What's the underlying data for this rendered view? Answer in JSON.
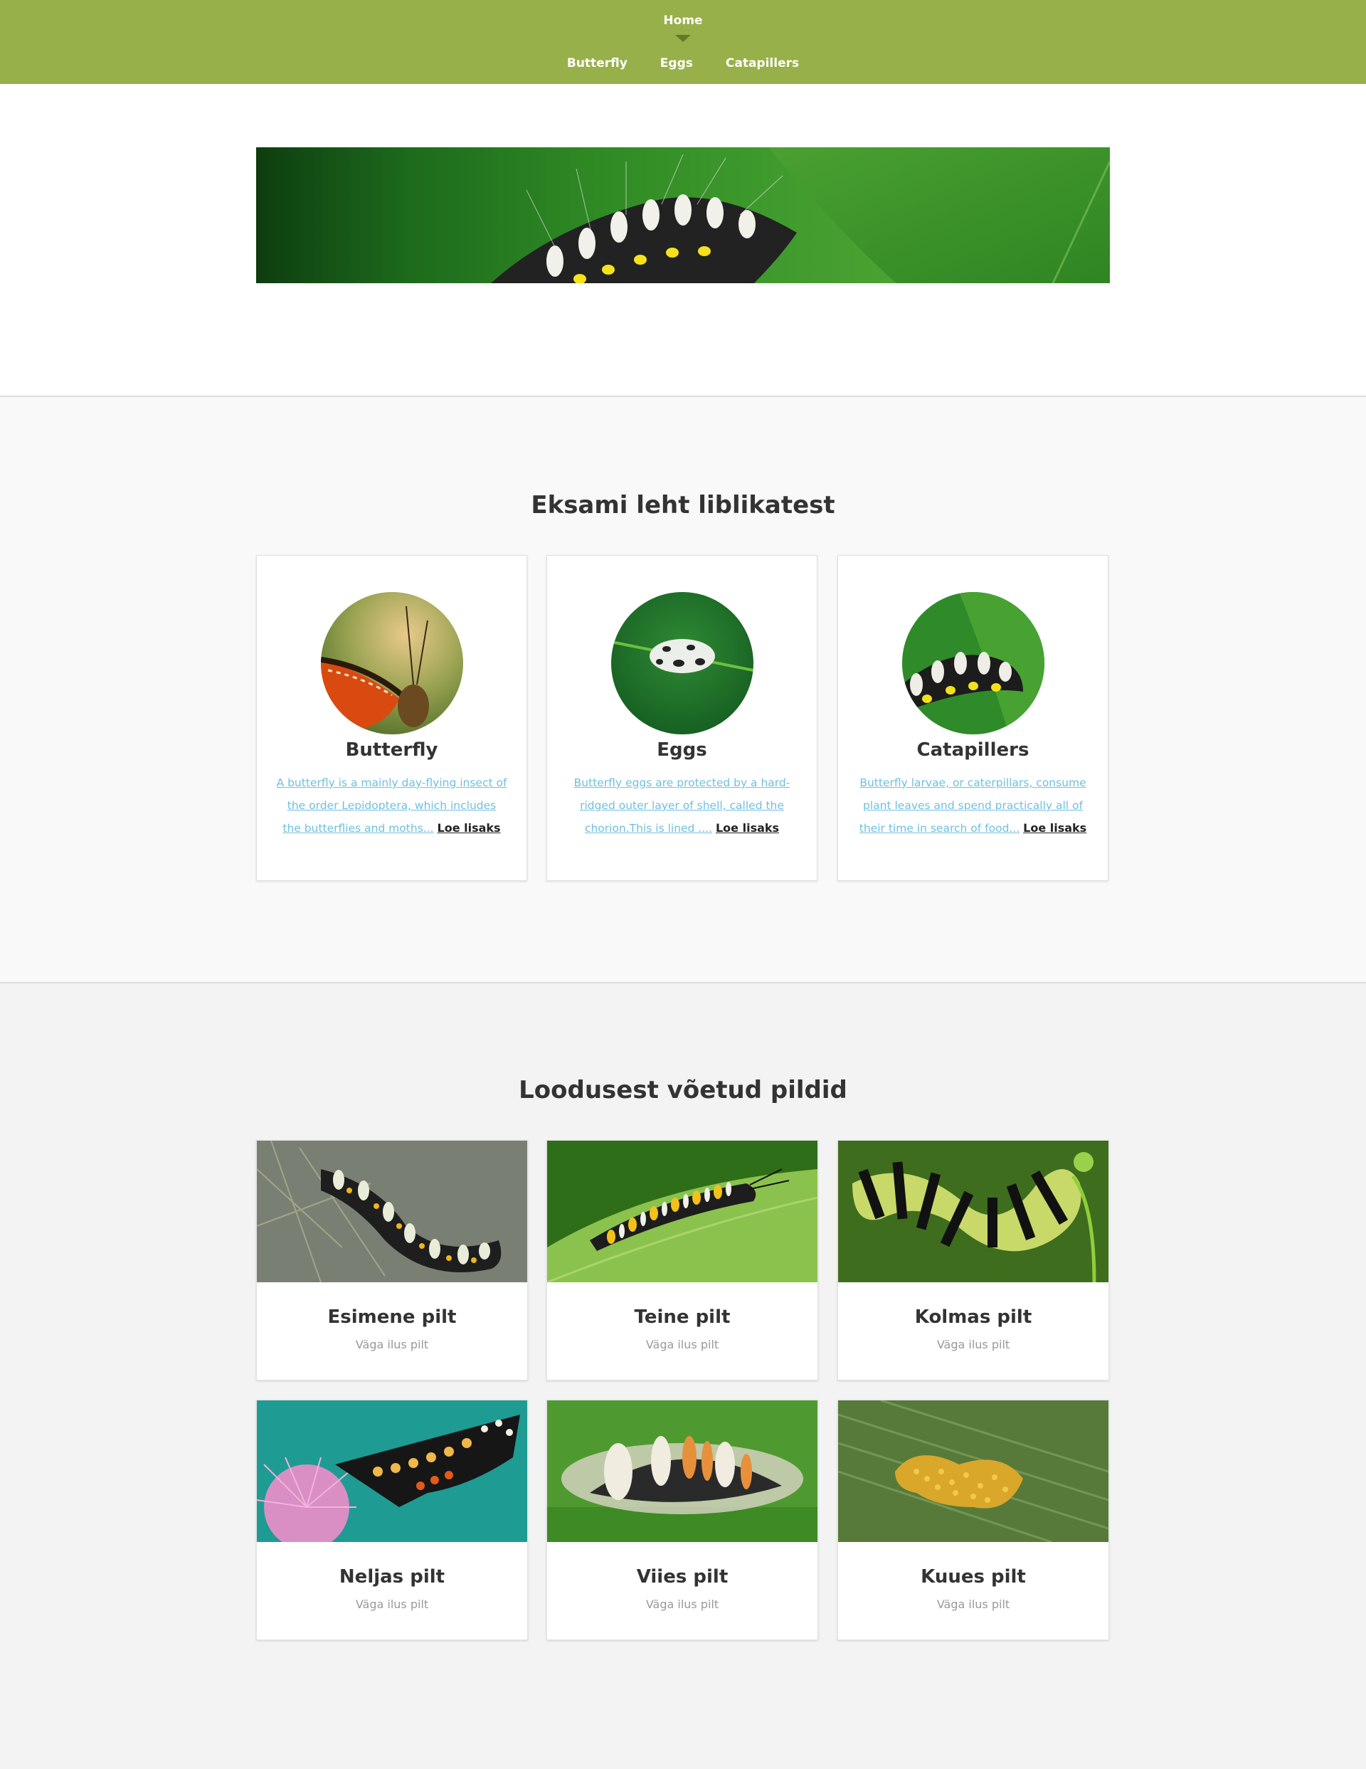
{
  "nav": {
    "home": "Home",
    "items": [
      "Butterfly",
      "Eggs",
      "Catapillers"
    ]
  },
  "about": {
    "title": "Eksami leht liblikatest",
    "cards": [
      {
        "title": "Butterfly",
        "lines": [
          "A butterfly is a mainly day-flying insect of",
          "the order Lepidoptera, which includes",
          "the butterflies and moths..."
        ],
        "more": "Loe lisaks"
      },
      {
        "title": "Eggs",
        "lines": [
          "Butterfly eggs are protected by a hard-",
          "ridged outer layer of shell, called the",
          "chorion.This is lined ...."
        ],
        "more": "Loe lisaks"
      },
      {
        "title": "Catapillers",
        "lines": [
          "Butterfly larvae, or caterpillars, consume",
          "plant leaves and spend practically all of",
          "their time in search of food..."
        ],
        "more": "Loe lisaks"
      }
    ]
  },
  "gallery": {
    "title": "Loodusest võetud pildid",
    "items": [
      {
        "title": "Esimene pilt",
        "subtitle": "Väga ilus pilt"
      },
      {
        "title": "Teine pilt",
        "subtitle": "Väga ilus pilt"
      },
      {
        "title": "Kolmas pilt",
        "subtitle": "Väga ilus pilt"
      },
      {
        "title": "Neljas pilt",
        "subtitle": "Väga ilus pilt"
      },
      {
        "title": "Viies pilt",
        "subtitle": "Väga ilus pilt"
      },
      {
        "title": "Kuues pilt",
        "subtitle": "Väga ilus pilt"
      }
    ]
  },
  "colors": {
    "header": "#97b04a",
    "link": "#6fbfe0"
  }
}
